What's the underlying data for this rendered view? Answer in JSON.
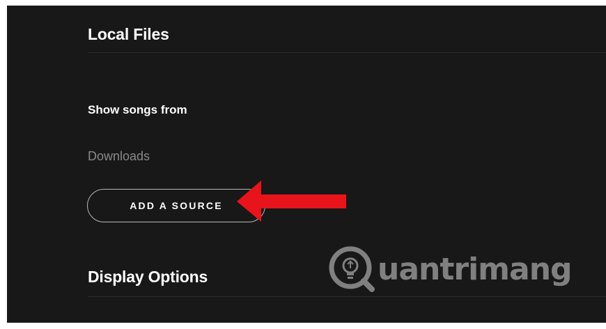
{
  "settings": {
    "local_files": {
      "title": "Local Files",
      "show_songs_from_label": "Show songs from",
      "sources": [
        "Downloads"
      ],
      "add_source_label": "ADD A SOURCE"
    },
    "display_options": {
      "title": "Display Options"
    }
  },
  "annotation": {
    "arrow_color": "#e8141c",
    "arrow_target": "add-a-source-button"
  },
  "watermark": {
    "text": "uantrimang",
    "logo_icon": "lightbulb-q-logo"
  },
  "colors": {
    "background": "#181818",
    "text_primary": "#ffffff",
    "text_muted": "#8a8a8a",
    "button_border": "#b8b8b8"
  }
}
